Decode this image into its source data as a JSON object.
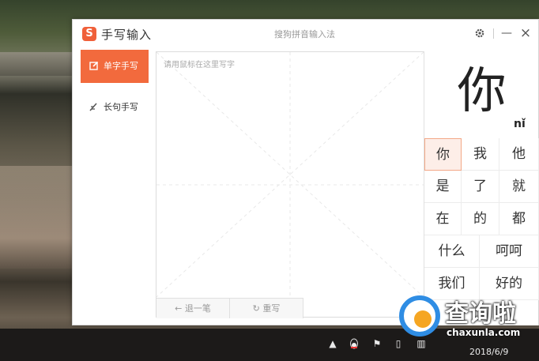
{
  "window": {
    "app_title": "手写输入",
    "logo_letter": "S",
    "caption": "搜狗拼音输入法",
    "settings_icon": "gear-icon",
    "minimize_label": "—",
    "close_label": "×"
  },
  "nav": {
    "items": [
      {
        "label": "单字手写",
        "icon": "edit-square-icon",
        "active": true
      },
      {
        "label": "长句手写",
        "icon": "pen-lines-icon",
        "active": false
      }
    ]
  },
  "pad": {
    "hint": "请用鼠标在这里写字",
    "undo_label": "退一笔",
    "rewrite_label": "重写"
  },
  "candidates": {
    "preview_char": "你",
    "preview_pinyin": "nǐ",
    "rows": [
      [
        "你",
        "我",
        "他"
      ],
      [
        "是",
        "了",
        "就"
      ],
      [
        "在",
        "的",
        "都"
      ],
      [
        "什么",
        "呵呵"
      ],
      [
        "我们",
        "好的"
      ]
    ],
    "selected": "你"
  },
  "taskbar": {
    "date": "2018/6/9"
  },
  "watermark": {
    "title": "查询啦",
    "url": "chaxunla.com"
  },
  "colors": {
    "accent": "#f26a3d",
    "selected_bg": "#fdeee8",
    "watermark_blue": "#2f8de4"
  }
}
